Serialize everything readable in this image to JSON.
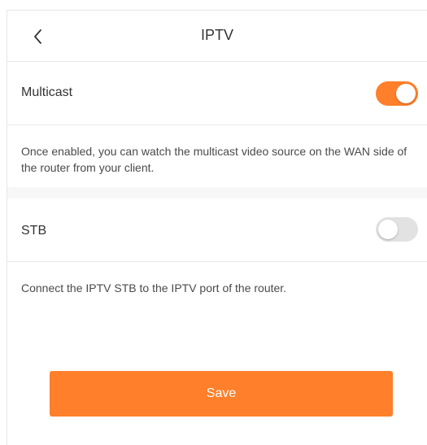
{
  "header": {
    "title": "IPTV",
    "back_icon": "chevron-left-icon"
  },
  "multicast": {
    "label": "Multicast",
    "enabled": true,
    "description": "Once enabled, you can watch the multicast video source on the WAN side of the router from your client."
  },
  "stb": {
    "label": "STB",
    "enabled": false,
    "description": "Connect the IPTV STB to the IPTV port of the router."
  },
  "actions": {
    "save_label": "Save"
  },
  "colors": {
    "accent": "#ff7f2a",
    "toggle_off": "#e2e2e2",
    "divider": "#e8e8e8",
    "section_gap": "#f7f7f7"
  }
}
